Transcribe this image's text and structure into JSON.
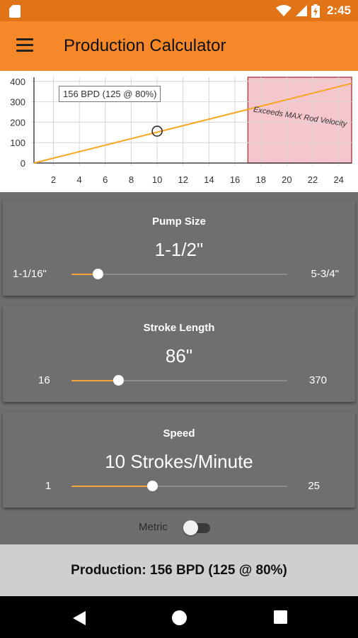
{
  "status_bar": {
    "time": "2:45",
    "icons": [
      "sd-card-icon",
      "wifi-icon",
      "signal-icon",
      "battery-charging-icon"
    ]
  },
  "app_bar": {
    "title": "Production Calculator",
    "menu_icon": "menu-icon"
  },
  "chart": {
    "tooltip": "156 BPD (125 @ 80%)",
    "zone_label": "Exceeds MAX Rod Velocity",
    "x_ticks": [
      "2",
      "4",
      "6",
      "8",
      "10",
      "12",
      "14",
      "16",
      "18",
      "20",
      "22",
      "24"
    ],
    "y_ticks": [
      "0",
      "100",
      "200",
      "300",
      "400"
    ]
  },
  "chart_data": {
    "type": "line",
    "title": "",
    "xlabel": "",
    "ylabel": "",
    "xlim": [
      0.5,
      25
    ],
    "ylim": [
      0,
      420
    ],
    "series": [
      {
        "x": [
          0.5,
          25
        ],
        "y": [
          0,
          390
        ],
        "color": "#f5a623"
      }
    ],
    "marker": {
      "x": 10,
      "y": 156
    },
    "shaded_region": {
      "x_start": 17,
      "x_end": 25,
      "color": "#f5c6cb",
      "label": "Exceeds MAX Rod Velocity"
    },
    "grid": true
  },
  "pump_size": {
    "title": "Pump Size",
    "value": "1-1/2\"",
    "min_label": "1-1/16\"",
    "max_label": "5-3/4\"",
    "position": 0.12
  },
  "stroke_length": {
    "title": "Stroke Length",
    "value": "86\"",
    "min_label": "16",
    "max_label": "370",
    "position": 0.215
  },
  "speed": {
    "title": "Speed",
    "value": "10 Strokes/Minute",
    "min_label": "1",
    "max_label": "25",
    "position": 0.375
  },
  "metric": {
    "label": "Metric",
    "enabled": false
  },
  "production": {
    "text": "Production: 156 BPD (125 @ 80%)"
  },
  "colors": {
    "status_bar": "#e07416",
    "app_bar": "#f7882a",
    "accent": "#f7a53a",
    "card": "#6f6f6f",
    "production_bar": "#cfcfcf"
  }
}
